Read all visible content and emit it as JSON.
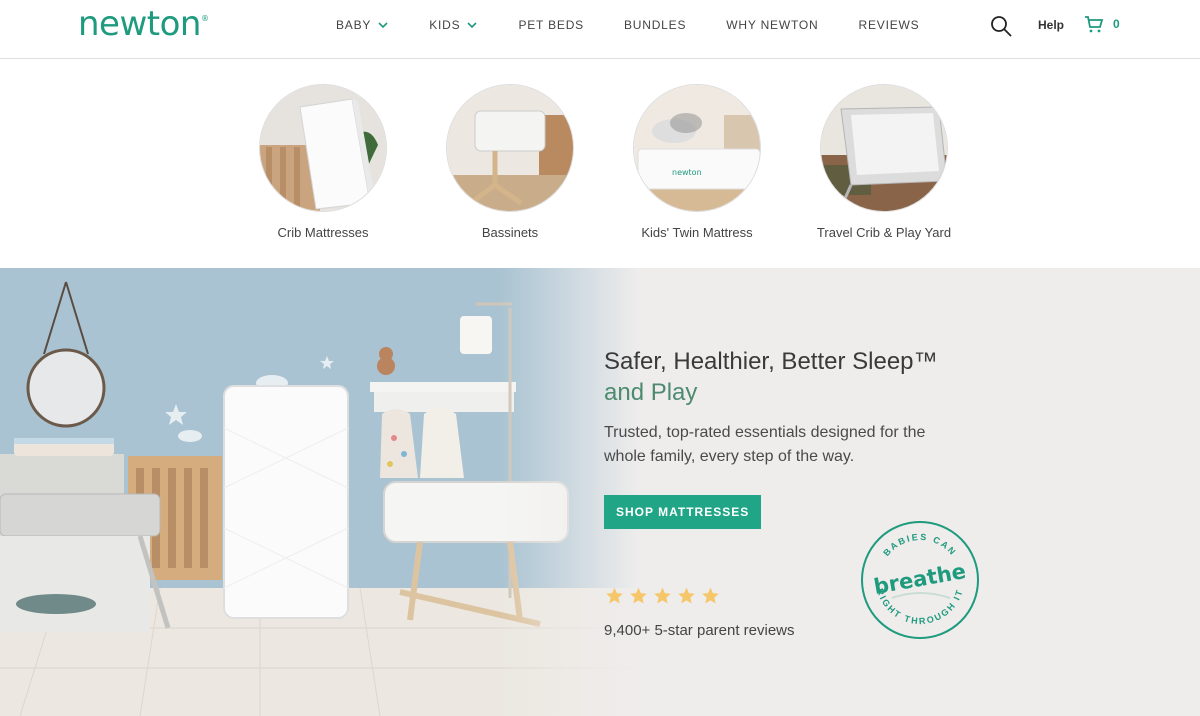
{
  "brand": {
    "logo": "newton",
    "accent": "#1e9a7e"
  },
  "nav": {
    "items": [
      {
        "label": "BABY",
        "dropdown": true
      },
      {
        "label": "KIDS",
        "dropdown": true
      },
      {
        "label": "PET BEDS",
        "dropdown": false
      },
      {
        "label": "BUNDLES",
        "dropdown": false
      },
      {
        "label": "WHY NEWTON",
        "dropdown": false
      },
      {
        "label": "REVIEWS",
        "dropdown": false
      }
    ],
    "help": "Help",
    "cart_count": "0"
  },
  "categories": [
    {
      "label": "Crib Mattresses"
    },
    {
      "label": "Bassinets"
    },
    {
      "label": "Kids' Twin Mattress"
    },
    {
      "label": "Travel Crib & Play Yard"
    }
  ],
  "hero": {
    "title_line1": "Safer, Healthier, Better Sleep™",
    "title_line2": "and Play",
    "subtitle": "Trusted, top-rated essentials designed for the whole family, every step of the way.",
    "cta": "SHOP MATTRESSES",
    "rating": 5,
    "reviews": "9,400+ 5-star parent reviews",
    "cta_color": "#20a686",
    "star_color": "#f5c76a",
    "badge": {
      "top": "BABIES CAN",
      "middle": "breathe",
      "bottom": "RIGHT THROUGH IT"
    }
  }
}
